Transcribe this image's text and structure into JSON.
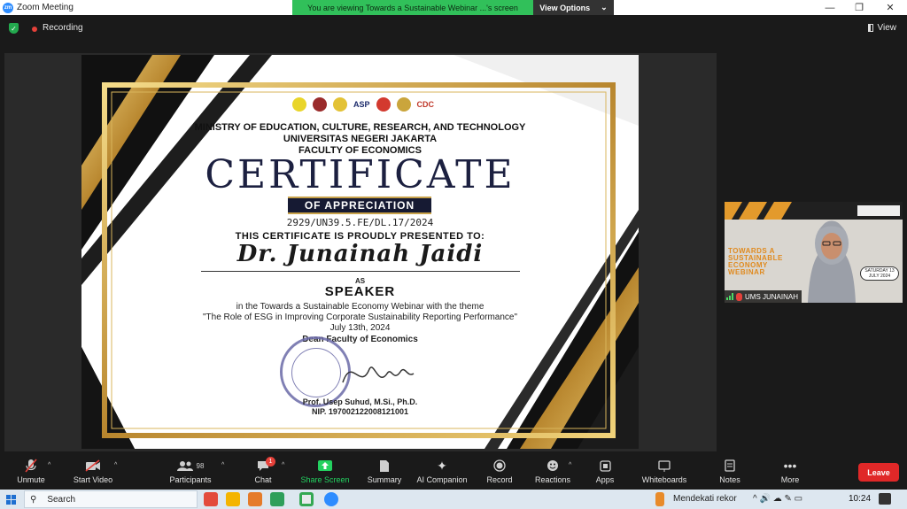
{
  "window": {
    "app_logo": "zm",
    "title": "Zoom Meeting",
    "minimize": "—",
    "restore": "❐",
    "close": "✕"
  },
  "share_banner": {
    "message": "You are viewing Towards a Sustainable Webinar ...'s screen",
    "options_label": "View Options",
    "options_caret": "⌄"
  },
  "meeting_bar": {
    "recording_label": "Recording",
    "view_label": "View"
  },
  "certificate": {
    "logos": [
      "ASP",
      "CDC"
    ],
    "ministry": "MINISTRY OF EDUCATION, CULTURE, RESEARCH, AND TECHNOLOGY",
    "university": "UNIVERSITAS NEGERI JAKARTA",
    "faculty": "FACULTY OF ECONOMICS",
    "title": "CERTIFICATE",
    "subtitle": "OF APPRECIATION",
    "number": "2929/UN39.5.FE/DL.17/2024",
    "presented": "THIS CERTIFICATE IS PROUDLY PRESENTED TO:",
    "recipient": "Dr. Junainah Jaidi",
    "as": "AS",
    "role": "SPEAKER",
    "theme_line1": "in the Towards a Sustainable Economy Webinar with the theme",
    "theme_line2": "\"The Role of ESG in Improving Corporate Sustainability Reporting Performance\"",
    "date": "July 13th, 2024",
    "dean": "Dean Faculty of Economics",
    "signer": "Prof. Usep Suhud, M.Si., Ph.D.",
    "nip": "NIP. 197002122008121001"
  },
  "participant": {
    "banner_title": "TOWARDS A SUSTAINABLE ECONOMY WEBINAR",
    "date_badge": "SATURDAY 13 JULY 2024",
    "name": "UMS JUNAINAH"
  },
  "toolbar": {
    "unmute": "Unmute",
    "start_video": "Start Video",
    "participants": "Participants",
    "participants_count": "98",
    "chat": "Chat",
    "chat_badge": "1",
    "share_screen": "Share Screen",
    "summary": "Summary",
    "ai_companion": "AI Companion",
    "record": "Record",
    "reactions": "Reactions",
    "apps": "Apps",
    "whiteboards": "Whiteboards",
    "notes": "Notes",
    "more": "More",
    "leave": "Leave"
  },
  "taskbar": {
    "search_label": "Search",
    "weather": "Mendekati rekor",
    "time": "10:24"
  },
  "colors": {
    "zoom_blue": "#2d8cff",
    "banner_green": "#31c05a",
    "leave_red": "#e02828",
    "gold": "#c8a24a"
  }
}
